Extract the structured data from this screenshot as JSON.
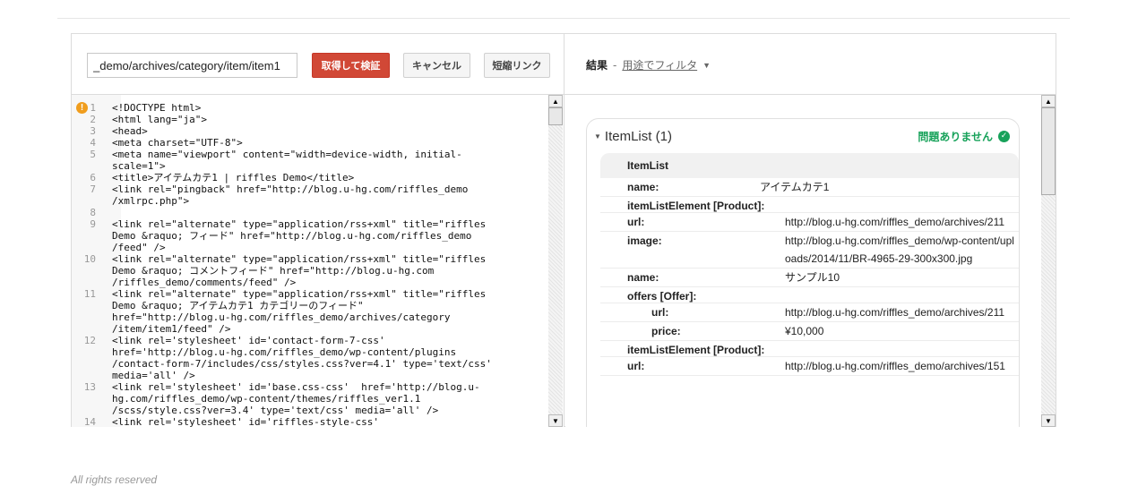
{
  "toolbar": {
    "url_value": "_demo/archives/category/item/item1",
    "fetch_label": "取得して検証",
    "cancel_label": "キャンセル",
    "shortlink_label": "短縮リンク"
  },
  "results": {
    "title": "結果",
    "separator": "-",
    "filter_label": "用途でフィルタ"
  },
  "code": {
    "lines": [
      {
        "n": "1",
        "t": "<!DOCTYPE html>"
      },
      {
        "n": "2",
        "t": "<html lang=\"ja\">"
      },
      {
        "n": "3",
        "t": "<head>"
      },
      {
        "n": "4",
        "t": "<meta charset=\"UTF-8\">"
      },
      {
        "n": "5",
        "t": "<meta name=\"viewport\" content=\"width=device-width, initial-\nscale=1\">"
      },
      {
        "n": "6",
        "t": "<title>アイテムカテ1 | riffles Demo</title>"
      },
      {
        "n": "7",
        "t": "<link rel=\"pingback\" href=\"http://blog.u-hg.com/riffles_demo\n/xmlrpc.php\">"
      },
      {
        "n": "8",
        "t": ""
      },
      {
        "n": "9",
        "t": "<link rel=\"alternate\" type=\"application/rss+xml\" title=\"riffles\nDemo &raquo; フィード\" href=\"http://blog.u-hg.com/riffles_demo\n/feed\" />"
      },
      {
        "n": "10",
        "t": "<link rel=\"alternate\" type=\"application/rss+xml\" title=\"riffles\nDemo &raquo; コメントフィード\" href=\"http://blog.u-hg.com\n/riffles_demo/comments/feed\" />"
      },
      {
        "n": "11",
        "t": "<link rel=\"alternate\" type=\"application/rss+xml\" title=\"riffles\nDemo &raquo; アイテムカテ1 カテゴリーのフィード\"\nhref=\"http://blog.u-hg.com/riffles_demo/archives/category\n/item/item1/feed\" />"
      },
      {
        "n": "12",
        "t": "<link rel='stylesheet' id='contact-form-7-css'\nhref='http://blog.u-hg.com/riffles_demo/wp-content/plugins\n/contact-form-7/includes/css/styles.css?ver=4.1' type='text/css'\nmedia='all' />"
      },
      {
        "n": "13",
        "t": "<link rel='stylesheet' id='base.css-css'  href='http://blog.u-\nhg.com/riffles_demo/wp-content/themes/riffles_ver1.1\n/scss/style.css?ver=3.4' type='text/css' media='all' />"
      },
      {
        "n": "14",
        "t": "<link rel='stylesheet' id='riffles-style-css'"
      }
    ]
  },
  "itemlist": {
    "title": "ItemList (1)",
    "status": "問題ありません",
    "table_header": "ItemList",
    "rows": [
      {
        "key": "name:",
        "value": "アイテムカテ1",
        "indent": 0
      },
      {
        "key": "itemListElement [Product]:",
        "value": "",
        "indent": 0
      },
      {
        "key": "url:",
        "value": "http://blog.u-hg.com/riffles_demo/archives/211",
        "indent": 1
      },
      {
        "key": "image:",
        "value": "http://blog.u-hg.com/riffles_demo/wp-content/uploads/2014/11/BR-4965-29-300x300.jpg",
        "indent": 1
      },
      {
        "key": "name:",
        "value": "サンプル10",
        "indent": 1
      },
      {
        "key": "offers [Offer]:",
        "value": "",
        "indent": 1
      },
      {
        "key": "url:",
        "value": "http://blog.u-hg.com/riffles_demo/archives/211",
        "indent": 2
      },
      {
        "key": "price:",
        "value": "¥10,000",
        "indent": 2
      },
      {
        "key": "itemListElement [Product]:",
        "value": "",
        "indent": 0
      },
      {
        "key": "url:",
        "value": "http://blog.u-hg.com/riffles_demo/archives/151",
        "indent": 1
      }
    ]
  },
  "footer": {
    "text": "All rights reserved"
  },
  "colors": {
    "accent_red": "#d14836",
    "ok_green": "#17a25a",
    "warn_orange": "#f09d1d"
  },
  "icons": {
    "warning": "warning-icon",
    "ok": "check-circle-icon",
    "dropdown": "caret-down-icon"
  }
}
